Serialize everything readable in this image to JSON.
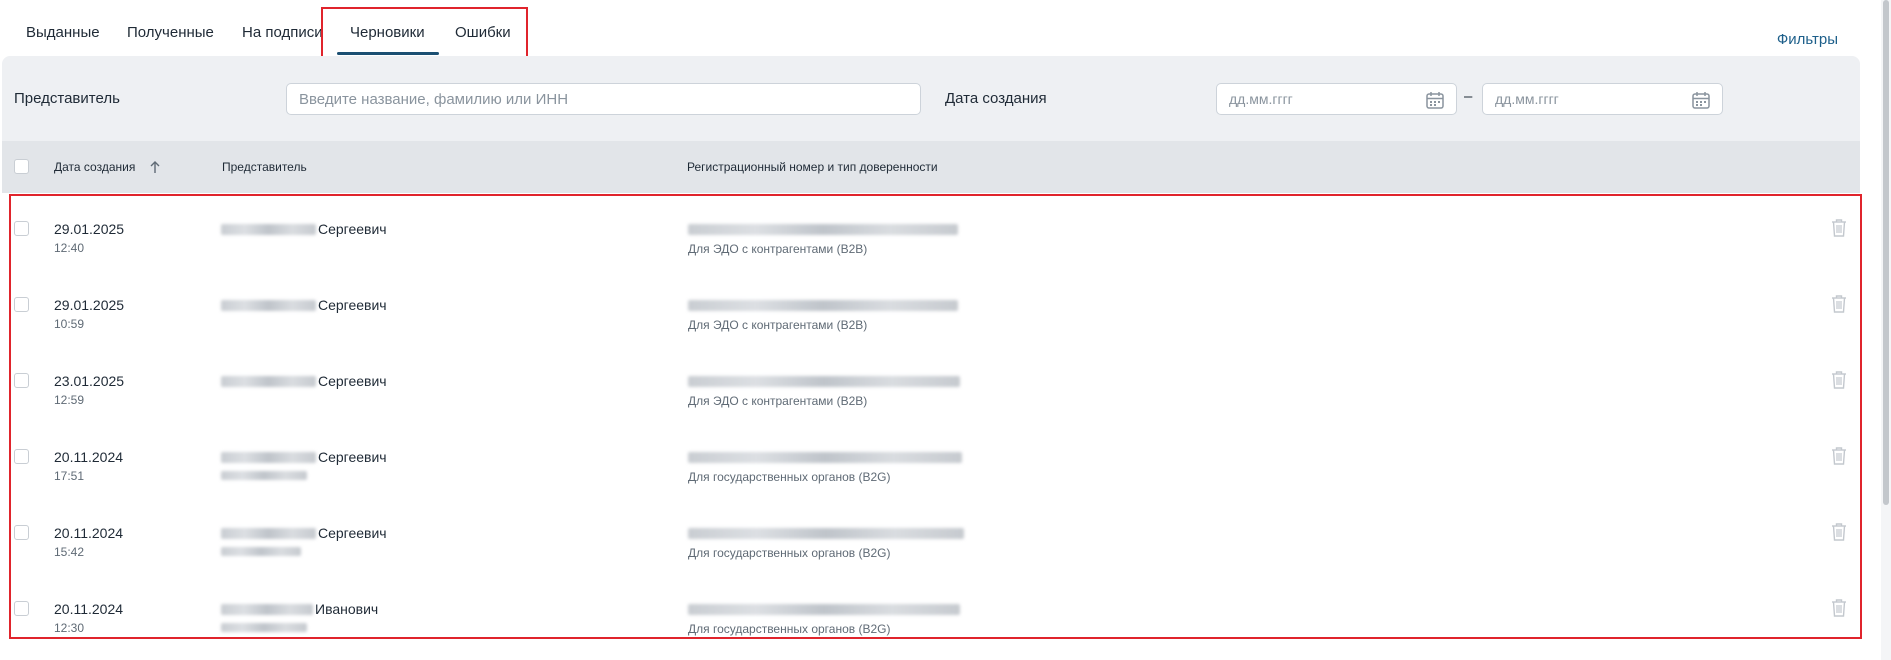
{
  "tabs": [
    {
      "label": "Выданные",
      "active": false
    },
    {
      "label": "Полученные",
      "active": false
    },
    {
      "label": "На подписи",
      "active": false
    },
    {
      "label": "Черновики",
      "active": true
    },
    {
      "label": "Ошибки",
      "active": false
    }
  ],
  "filters_link": "Фильтры",
  "filter_panel": {
    "representative_label": "Представитель",
    "search_placeholder": "Введите название, фамилию или ИНН",
    "created_label": "Дата создания",
    "date_from_placeholder": "дд.мм.гггг",
    "date_to_placeholder": "дд.мм.гггг",
    "range_separator": "–"
  },
  "table": {
    "columns": {
      "created": "Дата создания",
      "representative": "Представитель",
      "registration": "Регистрационный номер и тип доверенности"
    },
    "rows": [
      {
        "date": "29.01.2025",
        "time": "12:40",
        "rep_name": "Сергеевич",
        "doc_type": "Для ЭДО с контрагентами (B2B)"
      },
      {
        "date": "29.01.2025",
        "time": "10:59",
        "rep_name": "Сергеевич",
        "doc_type": "Для ЭДО с контрагентами (B2B)"
      },
      {
        "date": "23.01.2025",
        "time": "12:59",
        "rep_name": "Сергеевич",
        "doc_type": "Для ЭДО с контрагентами (B2B)"
      },
      {
        "date": "20.11.2024",
        "time": "17:51",
        "rep_name": "Сергеевич",
        "doc_type": "Для государственных органов (B2G)"
      },
      {
        "date": "20.11.2024",
        "time": "15:42",
        "rep_name": "Сергеевич",
        "doc_type": "Для государственных органов (B2G)"
      },
      {
        "date": "20.11.2024",
        "time": "12:30",
        "rep_name": "Иванович",
        "doc_type": "Для государственных органов (B2G)"
      }
    ]
  },
  "colors": {
    "accent": "#1b4f72",
    "link": "#1d5f8a",
    "highlight": "#e0242c",
    "panel_bg": "#eef0f3",
    "header_bg": "#e2e5e9"
  },
  "icons": {
    "calendar": "calendar-icon",
    "sort": "sort-up-arrow-icon",
    "delete": "trash-icon"
  }
}
